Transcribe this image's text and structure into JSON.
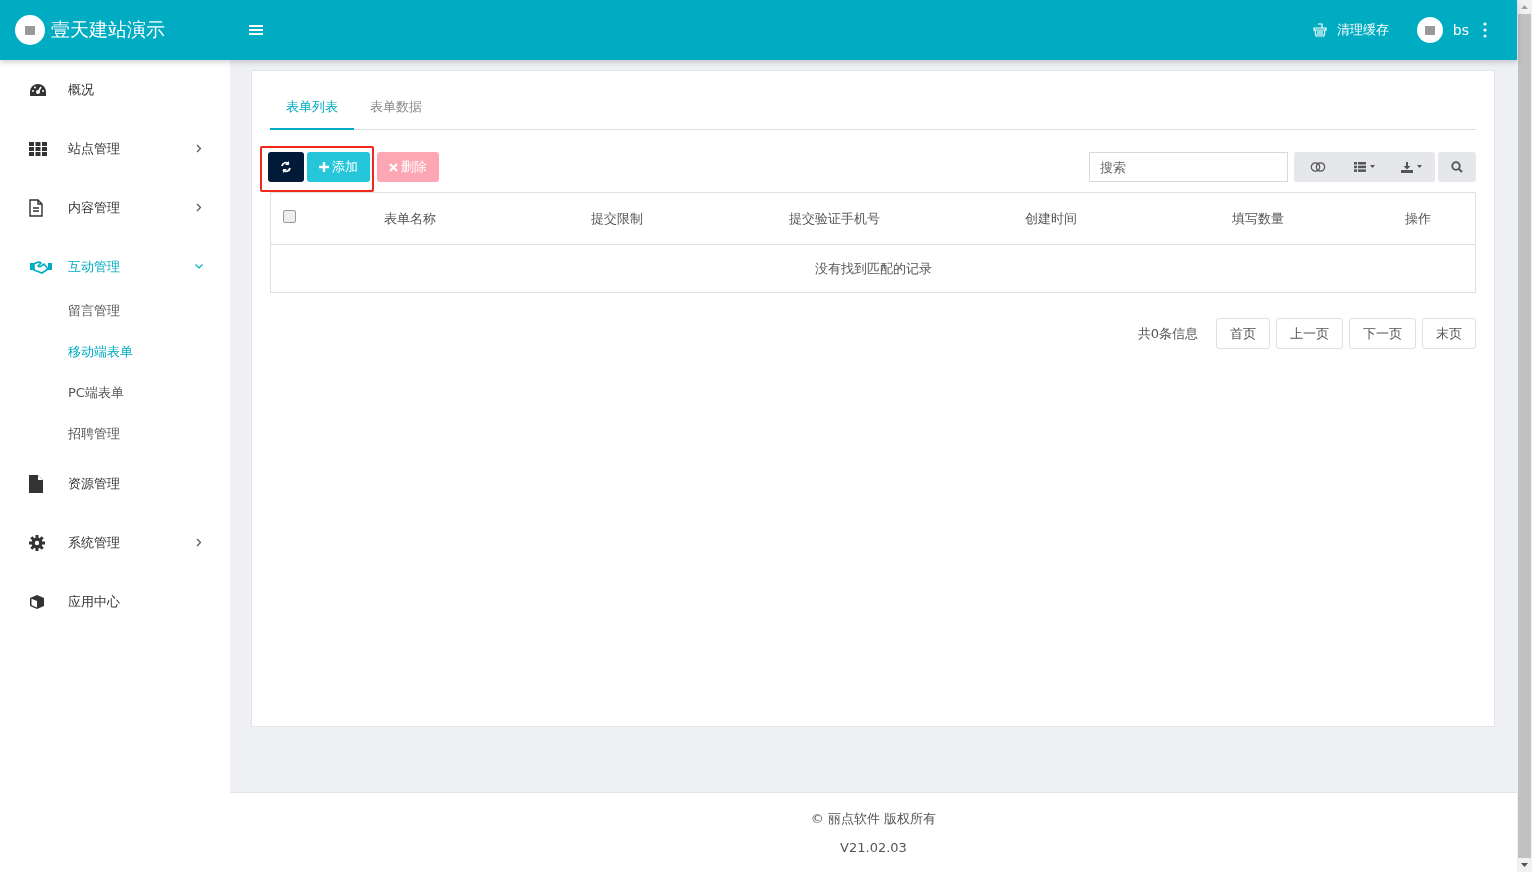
{
  "header": {
    "site_title": "壹天建站演示",
    "clear_cache": "清理缓存",
    "user": "bs"
  },
  "sidebar": {
    "items": [
      {
        "label": "概况",
        "kind": "link"
      },
      {
        "label": "站点管理",
        "kind": "group",
        "expanded": false
      },
      {
        "label": "内容管理",
        "kind": "group",
        "expanded": false
      },
      {
        "label": "互动管理",
        "kind": "group",
        "expanded": true,
        "children": [
          {
            "label": "留言管理",
            "selected": false
          },
          {
            "label": "移动端表单",
            "selected": true
          },
          {
            "label": "PC端表单",
            "selected": false
          },
          {
            "label": "招聘管理",
            "selected": false
          }
        ]
      },
      {
        "label": "资源管理",
        "kind": "link"
      },
      {
        "label": "系统管理",
        "kind": "group",
        "expanded": false
      },
      {
        "label": "应用中心",
        "kind": "link"
      }
    ]
  },
  "tabs": [
    {
      "label": "表单列表",
      "selected": true
    },
    {
      "label": "表单数据",
      "selected": false
    }
  ],
  "toolbar": {
    "add": "添加",
    "delete": "删除",
    "delete_disabled": true,
    "search": {
      "placeholder": "搜索"
    }
  },
  "table": {
    "select_all_checked": false,
    "columns": [
      "表单名称",
      "提交限制",
      "提交验证手机号",
      "创建时间",
      "填写数量",
      "操作"
    ],
    "empty_message": "没有找到匹配的记录"
  },
  "pagination": {
    "total": "共0条信息",
    "buttons": [
      "首页",
      "上一页",
      "下一页",
      "末页"
    ]
  },
  "footer": {
    "copyright": "© 丽点软件 版权所有",
    "version": "V21.02.03"
  }
}
